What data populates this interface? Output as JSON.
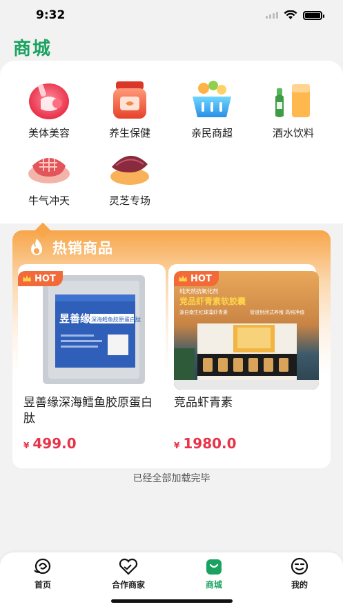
{
  "status_bar": {
    "time": "9:32"
  },
  "page": {
    "title": "商城"
  },
  "categories": [
    {
      "label": "美体美容",
      "icon": "beauty-icon"
    },
    {
      "label": "养生保健",
      "icon": "health-jar-icon"
    },
    {
      "label": "亲民商超",
      "icon": "shopping-basket-icon"
    },
    {
      "label": "酒水饮料",
      "icon": "drinks-icon"
    },
    {
      "label": "牛气冲天",
      "icon": "steak-icon"
    },
    {
      "label": "灵芝专场",
      "icon": "lingzhi-icon"
    }
  ],
  "hot_section": {
    "title": "热销商品",
    "badge": "HOT",
    "products": [
      {
        "name": "昱善缘深海鳕鱼胶原蛋白肽",
        "currency": "¥",
        "price": "499.0",
        "package_brand": "昱善缘",
        "package_text": "深海鳕鱼胶原蛋白肽"
      },
      {
        "name": "竞品虾青素",
        "currency": "¥",
        "price": "1980.0",
        "package_top": "纯天然抗氧化剂",
        "package_title": "竞品虾青素软胶囊",
        "package_line1": "源自南生红球藻虾青素",
        "package_line2": "管道封闭式养殖 高纯净值"
      }
    ]
  },
  "footer_text": "已经全部加载完毕",
  "tab_bar": {
    "tabs": [
      {
        "label": "首页",
        "icon": "home-swirl-icon"
      },
      {
        "label": "合作商家",
        "icon": "partner-heart-icon"
      },
      {
        "label": "商城",
        "icon": "shop-bag-icon"
      },
      {
        "label": "我的",
        "icon": "profile-face-icon"
      }
    ],
    "active_index": 2
  },
  "colors": {
    "brand_green": "#1aa260",
    "price_red": "#e8334a",
    "hot_orange": "#f7a64a"
  }
}
